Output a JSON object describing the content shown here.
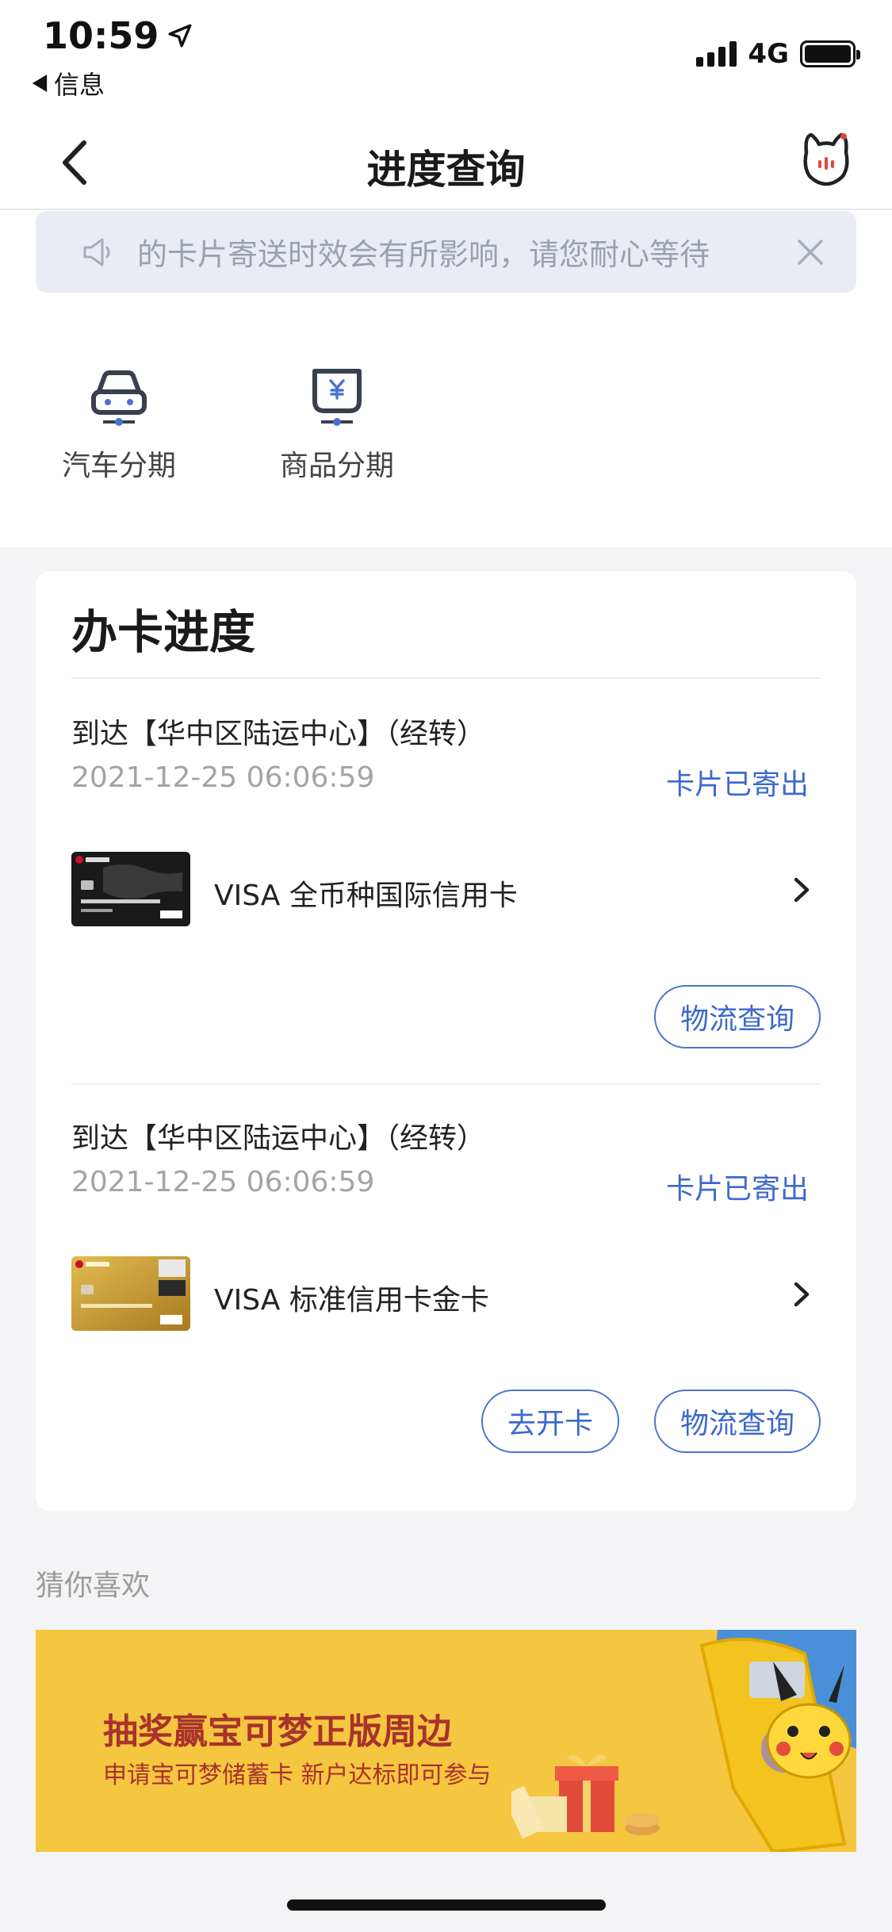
{
  "status_bar": {
    "time": "10:59",
    "back_app": "信息",
    "network": "4G"
  },
  "nav": {
    "title": "进度查询"
  },
  "notice": {
    "text": "的卡片寄送时效会有所影响，请您耐心等待"
  },
  "shortcuts": [
    {
      "label": "汽车分期",
      "icon": "car-icon"
    },
    {
      "label": "商品分期",
      "icon": "yen-goods-icon"
    }
  ],
  "progress": {
    "title": "办卡进度",
    "items": [
      {
        "location": "到达【华中区陆运中心】（经转）",
        "time": "2021-12-25 06:06:59",
        "status": "卡片已寄出",
        "card_name": "VISA 全币种国际信用卡",
        "buttons": [
          "物流查询"
        ]
      },
      {
        "location": "到达【华中区陆运中心】（经转）",
        "time": "2021-12-25 06:06:59",
        "status": "卡片已寄出",
        "card_name": "VISA 标准信用卡金卡",
        "buttons": [
          "去开卡",
          "物流查询"
        ]
      }
    ]
  },
  "recommend": {
    "heading": "猜你喜欢",
    "banner_title": "抽奖赢宝可梦正版周边",
    "banner_sub": "申请宝可梦储蓄卡 新户达标即可参与"
  },
  "colors": {
    "accent": "#3d69cd",
    "banner": "#f5c63f",
    "banner_text": "#a8322c"
  }
}
